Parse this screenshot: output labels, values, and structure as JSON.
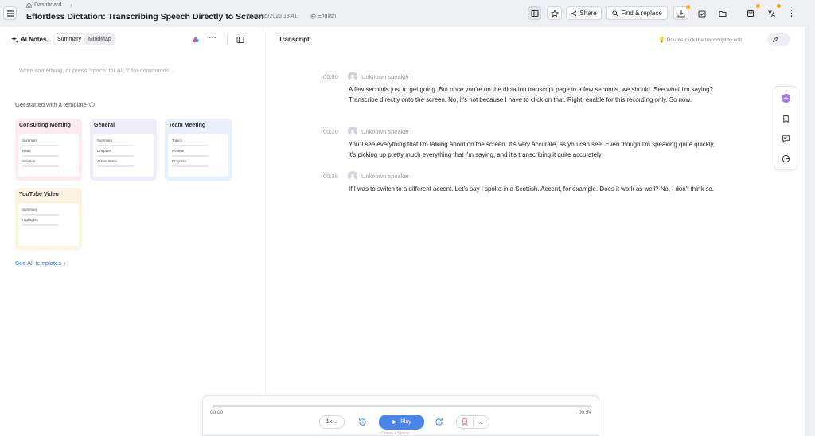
{
  "header": {
    "breadcrumb": "Dashboard",
    "title": "Effortless Dictation: Transcribing Speech Directly to Screen",
    "date": "06/05/2025 18:41",
    "language": "English",
    "share_label": "Share",
    "find_replace_label": "Find & replace"
  },
  "left_panel": {
    "title": "AI Notes",
    "tabs": [
      "Summary",
      "MindMap"
    ],
    "active_tab": "Summary",
    "input_placeholder": "Write something, or press 'space' for AI, '/' for commands...",
    "templates_heading": "Get started with a template",
    "templates": [
      {
        "name": "Consulting Meeting",
        "items": [
          "Summary",
          "Issue",
          "Solution"
        ],
        "bg": "#fdecef"
      },
      {
        "name": "General",
        "items": [
          "Summary",
          "Chapters",
          "Action Items"
        ],
        "bg": "#efedfb"
      },
      {
        "name": "Team Meeting",
        "items": [
          "Topics",
          "Review",
          "Progress"
        ],
        "bg": "#e8f0fc"
      },
      {
        "name": "YouTube Video",
        "items": [
          "Summary",
          "Highlights"
        ],
        "bg": "#fdf3e3"
      }
    ],
    "see_all": "See All templates"
  },
  "transcript": {
    "heading": "Transcript",
    "hint": "Double-click the transcript to edit",
    "segments": [
      {
        "time": "00:00",
        "speaker": "Unknown speaker",
        "text": "A few seconds just to get going. But once you're on the dictation transcript page in a few seconds, we should. See what I'm saying? Transcribe directly onto the screen. No, it's not because I have to click on that. Right, enable for this recording only. So now."
      },
      {
        "time": "00:20",
        "speaker": "Unknown speaker",
        "text": "You'll see everything that I'm talking about on the screen. It's very accurate, as you can see. Even though I'm speaking quite quickly, it's picking up pretty much everything that I'm saying, and it's transcribing it quite accurately."
      },
      {
        "time": "00:38",
        "speaker": "Unknown speaker",
        "text": "If I was to switch to a different accent. Let's say I spoke in a Scottish. Accent, for example. Does it work as well? No, I don't think so."
      }
    ]
  },
  "player": {
    "current_time": "00:00",
    "duration": "00:54",
    "speed": "1x",
    "play_label": "Play",
    "play_hint": "Option + Space",
    "skip_back_seconds": "3",
    "skip_forward_seconds": "3",
    "progress": 0
  },
  "colors": {
    "accent": "#4a86e8",
    "link": "#3a6fd9",
    "badge": "#f5a623"
  }
}
